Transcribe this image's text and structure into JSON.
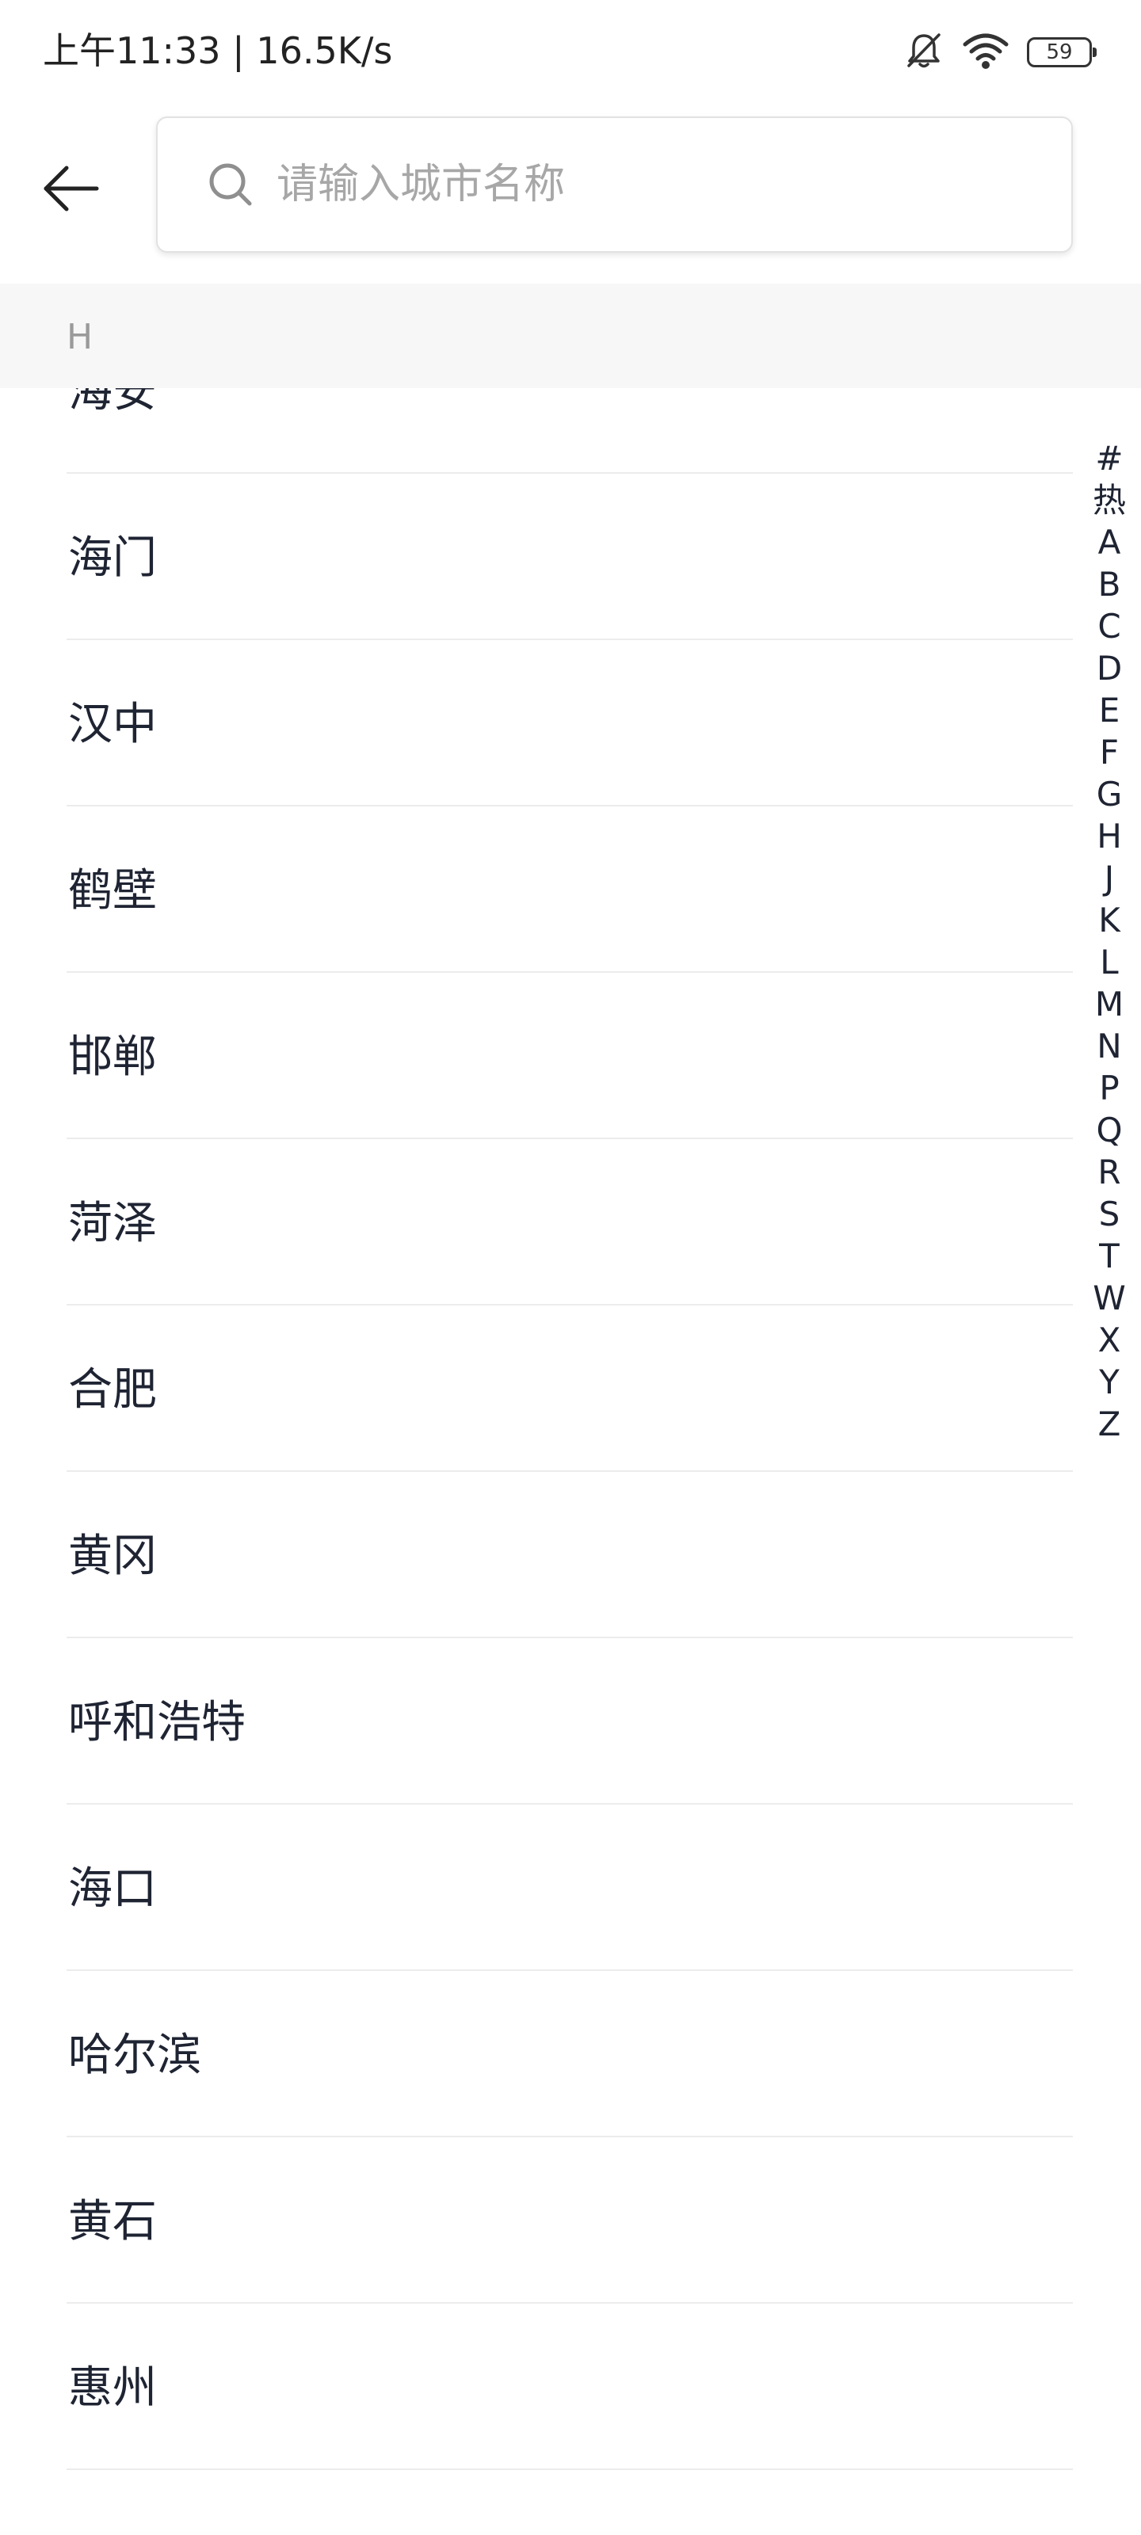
{
  "status_bar": {
    "time_speed": "上午11:33 | 16.5K/s",
    "battery": "59",
    "icons": [
      "bell-muted-icon",
      "wifi-icon",
      "battery-icon"
    ]
  },
  "header": {
    "back_icon": "arrow-left-icon",
    "search": {
      "icon": "search-icon",
      "placeholder": "请输入城市名称",
      "value": ""
    }
  },
  "section": {
    "letter": "H"
  },
  "cities": [
    {
      "name": "海安"
    },
    {
      "name": "海门"
    },
    {
      "name": "汉中"
    },
    {
      "name": "鹤壁"
    },
    {
      "name": "邯郸"
    },
    {
      "name": "菏泽"
    },
    {
      "name": "合肥"
    },
    {
      "name": "黄冈"
    },
    {
      "name": "呼和浩特"
    },
    {
      "name": "海口"
    },
    {
      "name": "哈尔滨"
    },
    {
      "name": "黄石"
    },
    {
      "name": "惠州"
    },
    {
      "name": ""
    }
  ],
  "alphabet_index": [
    "#",
    "热",
    "A",
    "B",
    "C",
    "D",
    "E",
    "F",
    "G",
    "H",
    "J",
    "K",
    "L",
    "M",
    "N",
    "P",
    "Q",
    "R",
    "S",
    "T",
    "W",
    "X",
    "Y",
    "Z"
  ],
  "colors": {
    "text_primary": "#1f2433",
    "placeholder": "#a7a7a7",
    "section_bg": "#f7f7f7",
    "divider": "#ececec"
  }
}
